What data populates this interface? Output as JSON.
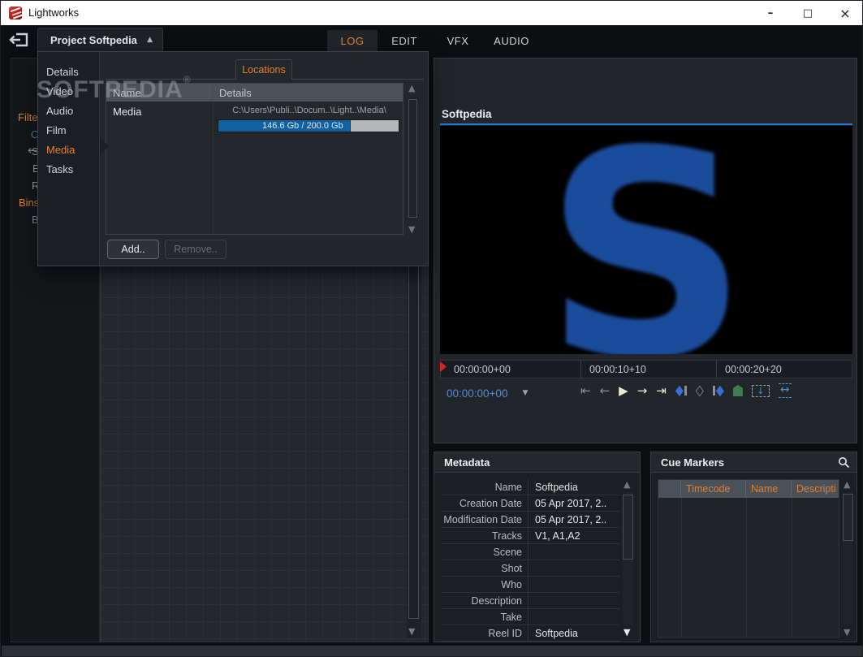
{
  "colors": {
    "accent_orange": "#e08430",
    "accent_blue": "#4d8fd0",
    "logo_blue": "#1b4c9c",
    "progress_blue": "#11609f",
    "progress_rest": "#b5b8bb",
    "cue_green": "#3f7d4e",
    "playhead_red": "#d42420"
  },
  "window": {
    "title": "Lightworks",
    "controls": [
      {
        "name": "minimize",
        "glyph": "–"
      },
      {
        "name": "maximize",
        "glyph": "□"
      },
      {
        "name": "close",
        "glyph": "×"
      }
    ]
  },
  "toolbar": {
    "project_tab": {
      "label": "Project Softpedia",
      "arrow": "▲"
    },
    "tabs": [
      {
        "label": "LOG",
        "active": true
      },
      {
        "label": "EDIT",
        "active": false
      },
      {
        "label": "VFX",
        "active": false
      },
      {
        "label": "AUDIO",
        "active": false
      }
    ]
  },
  "sidebar": {
    "back_arrow": "←",
    "fragments": [
      {
        "label": "Filte",
        "color": "orange"
      },
      {
        "label": "C",
        "color": "blue"
      },
      {
        "label": "S",
        "color": "gray"
      },
      {
        "label": "E",
        "color": "gray"
      },
      {
        "label": "R",
        "color": "gray"
      },
      {
        "label": "Bins",
        "color": "orange"
      },
      {
        "label": "B",
        "color": "slate"
      }
    ]
  },
  "project_panel": {
    "menu": [
      "Details",
      "Video",
      "Audio",
      "Film",
      "Media",
      "Tasks"
    ],
    "selected_menu": "Media",
    "tab": "Locations",
    "table": {
      "columns": [
        "Name",
        "Details"
      ],
      "rows": [
        {
          "name": "Media",
          "path": "C:\\Users\\Publi..\\Docum..\\Light..\\Media\\",
          "usage": "146.6 Gb / 200.0 Gb",
          "percent_used": 73.3
        }
      ]
    },
    "buttons": [
      {
        "label": "Add..",
        "enabled": true
      },
      {
        "label": "Remove..",
        "enabled": false
      }
    ]
  },
  "watermark": {
    "text": "SOFTPEDIA",
    "reg": "®"
  },
  "viewer": {
    "title": "Softpedia",
    "logo_letter": "S",
    "ruler": [
      "00:00:00+00",
      "00:00:10+10",
      "00:00:20+20"
    ],
    "timecode": "00:00:00+00",
    "timecode_dropdown": "▼",
    "transport": [
      {
        "name": "jump-to-start",
        "glyph": "⇤"
      },
      {
        "name": "step-back",
        "glyph": "←"
      },
      {
        "name": "play",
        "glyph": "▶"
      },
      {
        "name": "step-forward",
        "glyph": "→"
      },
      {
        "name": "jump-to-end",
        "glyph": "⇥"
      },
      {
        "name": "mark-in",
        "glyph": "◆"
      },
      {
        "name": "mark-clear",
        "glyph": "◇"
      },
      {
        "name": "mark-out",
        "glyph": "◆"
      },
      {
        "name": "add-cue-marker",
        "glyph": ""
      },
      {
        "name": "insert-down",
        "glyph": "↓"
      },
      {
        "name": "fit-width",
        "glyph": "↔"
      }
    ]
  },
  "metadata": {
    "title": "Metadata",
    "rows": [
      {
        "label": "Name",
        "value": "Softpedia"
      },
      {
        "label": "Creation Date",
        "value": "05 Apr 2017, 2.."
      },
      {
        "label": "Modification Date",
        "value": "05 Apr 2017, 2.."
      },
      {
        "label": "Tracks",
        "value": "V1, A1,A2"
      },
      {
        "label": "Scene",
        "value": ""
      },
      {
        "label": "Shot",
        "value": ""
      },
      {
        "label": "Who",
        "value": ""
      },
      {
        "label": "Description",
        "value": ""
      },
      {
        "label": "Take",
        "value": ""
      },
      {
        "label": "Reel ID",
        "value": "Softpedia"
      }
    ]
  },
  "cue_markers": {
    "title": "Cue Markers",
    "columns": [
      "",
      "Timecode",
      "Name",
      "Descripti"
    ]
  }
}
